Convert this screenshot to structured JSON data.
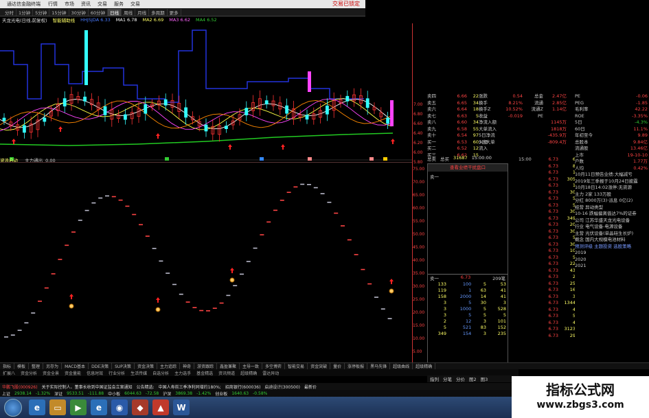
{
  "window": {
    "title": "通达信金融终端",
    "menu": [
      "行情",
      "市场",
      "资讯",
      "交易",
      "服务",
      "交易"
    ],
    "status": "交易已锁定"
  },
  "periods": [
    "分时",
    "1分钟",
    "5分钟",
    "15分钟",
    "30分钟",
    "60分钟",
    "日线",
    "周线",
    "月线",
    "多周期",
    "更多"
  ],
  "active_period": "日线",
  "info_bar": {
    "stock": "天龙光电(日线,前复权)",
    "indicator": "智能辅助线",
    "hh": "HHJSJDA 6.33",
    "ma_items": [
      "MA1 6.78",
      "MA2 6.69",
      "MA3 6.62",
      "MA4 6.52"
    ]
  },
  "separator_bar": {
    "indicator_name": "波浪启动",
    "label": "主力通出",
    "value": "0.00"
  },
  "price_axis": [
    "7.00",
    "6.80",
    "6.60",
    "6.40",
    "6.20",
    "6.00",
    "5.80"
  ],
  "indicator_axis": [
    "75.00",
    "70.00",
    "65.00",
    "60.00",
    "55.00",
    "50.00",
    "45.00",
    "40.00",
    "35.00",
    "30.00",
    "25.00",
    "20.00",
    "15.00",
    "10.00",
    "5.00"
  ],
  "orderbook": [
    {
      "label": "卖四",
      "price": "6.66",
      "vol": "22"
    },
    {
      "label": "卖五",
      "price": "6.65",
      "vol": "34"
    },
    {
      "label": "卖六",
      "price": "6.64",
      "vol": "18"
    },
    {
      "label": "卖七",
      "price": "6.63",
      "vol": "5"
    },
    {
      "label": "卖八",
      "price": "6.60",
      "vol": "34"
    },
    {
      "label": "卖九",
      "price": "6.58",
      "vol": "55"
    },
    {
      "label": "卖十",
      "price": "6.54",
      "vol": "97"
    },
    {
      "label": "买一",
      "price": "6.53",
      "vol": "60"
    },
    {
      "label": "买二",
      "price": "6.52",
      "vol": "12"
    },
    {
      "label": "买三",
      "price": "6.62",
      "vol": "15"
    }
  ],
  "stats": [
    {
      "a": "涨跌",
      "b": "0.54",
      "c": "总金",
      "d": "2.47亿"
    },
    {
      "a": "换手",
      "b": "8.21%",
      "c": "流通",
      "d": "2.85亿"
    },
    {
      "a": "换手Z",
      "b": "10.52%",
      "c": "流通Z",
      "d": "1.14亿"
    },
    {
      "a": "收益",
      "b": "-0.019",
      "c": "PE",
      "d": ""
    },
    {
      "a": "净流入额",
      "b": "",
      "c": "",
      "d": "1145万"
    },
    {
      "a": "大单流入",
      "b": "",
      "c": "",
      "d": "1818万"
    },
    {
      "a": "5日净流入额",
      "b": "",
      "c": "",
      "d": "-435.9万"
    },
    {
      "a": "5日大单流入",
      "b": "",
      "c": "",
      "d": "-809.4万"
    }
  ],
  "wk_total": {
    "label1": "总卖",
    "label2": "总买",
    "val": "31687",
    "time": "15:00:00"
  },
  "detail_window": {
    "title": "查看业绩干扰盘口",
    "head_left": "卖一",
    "head_price": "6.73",
    "head_right": "209笔",
    "top_label": "卖一",
    "rows": [
      [
        "133",
        "100",
        "5",
        "53"
      ],
      [
        "119",
        "1",
        "63",
        "41"
      ],
      [
        "158",
        "2000",
        "14",
        "41"
      ],
      [
        "3",
        "5",
        "30",
        "3"
      ],
      [
        "3",
        "1000",
        "5",
        "528"
      ],
      [
        "3",
        "5",
        "5",
        "5"
      ],
      [
        "2",
        "12",
        "3",
        "101"
      ],
      [
        "5",
        "521",
        "83",
        "152"
      ],
      [
        "349",
        "154",
        "3",
        "235"
      ]
    ]
  },
  "ticks": [
    {
      "t": "15:00",
      "p": "6.73",
      "v": "6"
    },
    {
      "t": "",
      "p": "6.73",
      "v": "8"
    },
    {
      "t": "",
      "p": "6.73",
      "v": "1"
    },
    {
      "t": "",
      "p": "6.73",
      "v": "305"
    },
    {
      "t": "",
      "p": "6.73",
      "v": "1"
    },
    {
      "t": "",
      "p": "6.73",
      "v": "30"
    },
    {
      "t": "",
      "p": "6.73",
      "v": "5"
    },
    {
      "t": "",
      "p": "6.73",
      "v": "5"
    },
    {
      "t": "",
      "p": "6.73",
      "v": "30"
    },
    {
      "t": "",
      "p": "6.73",
      "v": "349"
    },
    {
      "t": "",
      "p": "6.73",
      "v": "20"
    },
    {
      "t": "",
      "p": "6.73",
      "v": "30"
    },
    {
      "t": "",
      "p": "6.73",
      "v": "5"
    },
    {
      "t": "",
      "p": "6.73",
      "v": "30"
    },
    {
      "t": "",
      "p": "6.73",
      "v": "10"
    },
    {
      "t": "",
      "p": "6.73",
      "v": "5"
    },
    {
      "t": "",
      "p": "6.73",
      "v": "22"
    },
    {
      "t": "",
      "p": "6.73",
      "v": "43"
    },
    {
      "t": "",
      "p": "6.73",
      "v": "2"
    },
    {
      "t": "",
      "p": "6.73",
      "v": "25"
    },
    {
      "t": "",
      "p": "6.73",
      "v": "16"
    },
    {
      "t": "",
      "p": "6.73",
      "v": "3"
    },
    {
      "t": "",
      "p": "6.73",
      "v": "1344"
    },
    {
      "t": "",
      "p": "6.73",
      "v": "4"
    },
    {
      "t": "",
      "p": "6.73",
      "v": "5"
    },
    {
      "t": "",
      "p": "6.73",
      "v": "4"
    },
    {
      "t": "",
      "p": "6.73",
      "v": "3123"
    },
    {
      "t": "",
      "p": "6.73",
      "v": "29"
    }
  ],
  "f10": {
    "kv": [
      {
        "k": "PE",
        "v": "-0.06",
        "green": false
      },
      {
        "k": "PEG",
        "v": "-1.85",
        "green": false
      },
      {
        "k": "毛利率",
        "v": "42.22",
        "green": false
      },
      {
        "k": "ROE",
        "v": "-3.35%",
        "green": false
      },
      {
        "k": "5日",
        "v": "-4.3%",
        "green": true
      },
      {
        "k": "60日",
        "v": "11.1%",
        "green": false
      },
      {
        "k": "年初至今",
        "v": "9.89",
        "green": false
      },
      {
        "k": "总股本",
        "v": "9.84亿",
        "green": false
      },
      {
        "k": "流通股",
        "v": "13.46亿",
        "green": false
      },
      {
        "k": "上市",
        "v": "19-10-10",
        "green": false
      },
      {
        "k": "户数",
        "v": "1.77万",
        "green": false
      },
      {
        "k": "人均",
        "v": "0.42%",
        "green": false
      }
    ],
    "lines": [
      "10月11日预告业绩:大幅减亏",
      "2019年三季报于10月24日披露",
      "10月18日14:02涨停:无资源",
      "主力 2家 133万股",
      "分红 8000万(3)·派息 0亿(2)",
      "经营 异动类型",
      "10-16 跌幅偏离值达7%的证券",
      "公司 江苏华盛天龙光电设备",
      "行业 电气设备-电源设备",
      "主营 光伏设备(单晶硅生长炉)",
      "概念 国内大规模电池材料",
      "预测评级 主题投资 选股策略"
    ],
    "years": [
      "2019",
      "2020",
      "2021"
    ]
  },
  "bottom_toolbar": [
    "指标",
    "模板",
    "整理",
    "另存为",
    "MACD基本",
    "DDE决策",
    "SUP决策",
    "资金决策",
    "主力追踪",
    "神奇",
    "游资跟踪",
    "鑫盈兼聚",
    "主导一致",
    "多空博弈",
    "智能交易",
    "资金突破",
    "量价",
    "涨停板报",
    "黑马先锋",
    "超级曲线",
    "超级精确"
  ],
  "bottom_tabs": [
    "扩展八",
    "资金分析",
    "资金全景",
    "资金量能",
    "信息时效",
    "行业分析",
    "生活传媒",
    "自选分析",
    "主力选手",
    "基金精选",
    "资讯频道",
    "超级精确",
    "雷达异动"
  ],
  "right_tabs": [
    "指列",
    "分笔",
    "分价",
    "图2",
    "图3"
  ],
  "news": [
    "华鹏飞股(000926)",
    "关于实际控制人、董事长收到中国证监会立案通知",
    "公告精选:",
    "中国人寿前三季净利同增约180%;",
    "招商银行(600036)",
    "启迪设计(300500)",
    "最新价"
  ],
  "indices": [
    {
      "name": "上证",
      "val": "2938.14",
      "chg": "-1.32%",
      "up": false
    },
    {
      "name": "深证",
      "val": "9533.51",
      "chg": "-111.88",
      "up": false
    },
    {
      "name": "中小板",
      "val": "6044.63",
      "chg": "-72.58",
      "up": false
    },
    {
      "name": "沪深",
      "val": "3869.38",
      "chg": "-1.42%",
      "up": false
    },
    {
      "name": "创业板",
      "val": "1640.63",
      "chg": "-0.58%",
      "up": false
    }
  ],
  "watermark": {
    "title": "指标公式网",
    "url": "www.zbgs3.com"
  }
}
